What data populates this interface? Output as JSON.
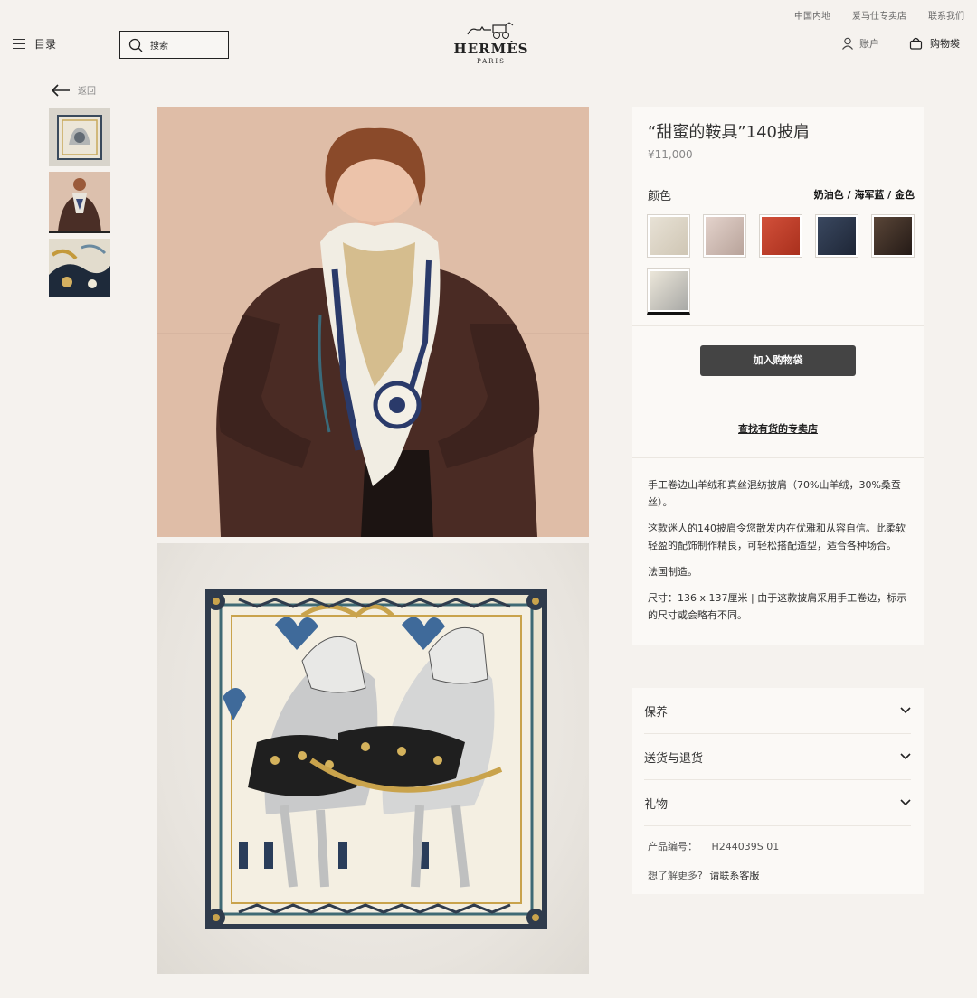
{
  "util": {
    "items": [
      "中国内地",
      "爱马仕专卖店",
      "联系我们"
    ]
  },
  "header": {
    "menu_label": "目录",
    "search_placeholder": "搜索",
    "brand": "HERMÈS",
    "city": "PARIS",
    "account_label": "账户",
    "cart_label": "购物袋"
  },
  "back_label": "返回",
  "thumbnails": [
    "scarf-flat",
    "model-wearing",
    "scarf-detail"
  ],
  "product": {
    "title": "“甜蜜的鞍具”140披肩",
    "price": "¥11,000",
    "color_label": "颜色",
    "color_value": "奶油色 / 海军蓝 / 金色",
    "swatches": [
      {
        "name": "cream",
        "color": "#e8e2d6"
      },
      {
        "name": "pink",
        "color": "#d9c7c0"
      },
      {
        "name": "red",
        "color": "#c9432c"
      },
      {
        "name": "navy",
        "color": "#2b3548"
      },
      {
        "name": "brown",
        "color": "#3a2e28"
      },
      {
        "name": "cream-navy-gold",
        "color": "#e2ddd2"
      }
    ],
    "add_to_cart": "加入购物袋",
    "find_store": "查找有货的专卖店",
    "desc": [
      "手工卷边山羊绒和真丝混纺披肩（70%山羊绒，30%桑蚕丝）。",
      "这款迷人的140披肩令您散发内在优雅和从容自信。此柔软轻盈的配饰制作精良，可轻松搭配造型，适合各种场合。",
      "法国制造。",
      "尺寸：136 x 137厘米 | 由于这款披肩采用手工卷边，标示的尺寸或会略有不同。"
    ]
  },
  "accordion": [
    "保养",
    "送货与退货",
    "礼物"
  ],
  "info": {
    "product_code_label": "产品编号：",
    "product_code": "H244039S 01",
    "more_label": "想了解更多?",
    "contact_label": "请联系客服"
  },
  "colors": {
    "accent": "#444444",
    "page_bg": "#f5f2ee",
    "panel_bg": "#fbf9f6"
  }
}
